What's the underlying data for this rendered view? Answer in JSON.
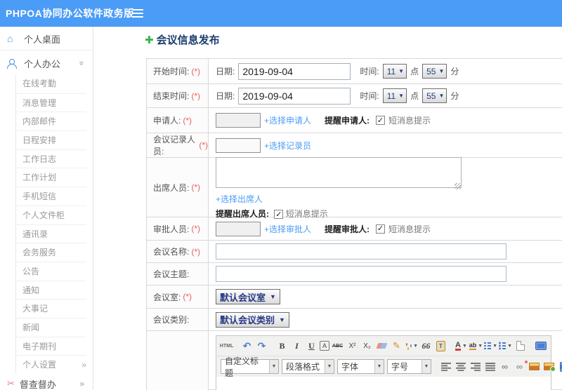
{
  "header": {
    "title": "PHPOA协同办公软件政务版"
  },
  "sidebar": {
    "desktop": {
      "label": "个人桌面"
    },
    "personal_office": {
      "label": "个人办公",
      "children": [
        "在线考勤",
        "消息管理",
        "内部邮件",
        "日程安排",
        "工作日志",
        "工作计划",
        "手机短信",
        "个人文件柜",
        "通讯录",
        "会务服务",
        "公告",
        "通知",
        "大事记",
        "新闻",
        "电子期刊"
      ]
    },
    "personal_settings": {
      "label": "个人设置"
    },
    "supervision": {
      "label": "督查督办"
    }
  },
  "page": {
    "title": "会议信息发布"
  },
  "form": {
    "required_mark": "(*)",
    "start_time": {
      "label": "开始时间:",
      "date_label": "日期:",
      "date_value": "2019-09-04",
      "time_label": "时间:",
      "hour": "11",
      "hour_unit": "点",
      "minute": "55",
      "minute_unit": "分"
    },
    "end_time": {
      "label": "结束时间:",
      "date_label": "日期:",
      "date_value": "2019-09-04",
      "time_label": "时间:",
      "hour": "11",
      "hour_unit": "点",
      "minute": "55",
      "minute_unit": "分"
    },
    "applicant": {
      "label": "申请人:",
      "link": "+选择申请人",
      "remind_label": "提醒申请人:",
      "sms_label": "短消息提示"
    },
    "recorder": {
      "label": "会议记录人员:",
      "link": "+选择记录员"
    },
    "attendees": {
      "label": "出席人员:",
      "link": "+选择出席人",
      "remind_label": "提醒出席人员:",
      "sms_label": "短消息提示"
    },
    "approver": {
      "label": "审批人员:",
      "link": "+选择审批人",
      "remind_label": "提醒审批人:",
      "sms_label": "短消息提示"
    },
    "meeting_name": {
      "label": "会议名称:"
    },
    "meeting_subject": {
      "label": "会议主题:"
    },
    "meeting_room": {
      "label": "会议室:",
      "value": "默认会议室"
    },
    "meeting_category": {
      "label": "会议类别:",
      "value": "默认会议类别"
    }
  },
  "editor": {
    "toolbar1": {
      "html": "HTML",
      "undo": "↶",
      "redo": "↷",
      "bold": "B",
      "italic": "I",
      "underline": "U",
      "font_box": "A",
      "strike": "ABC",
      "sup": "X²",
      "sub": "X₂",
      "broom": "✎",
      "quote": "66",
      "paste": "T",
      "font_color": "A",
      "highlight": "ab"
    },
    "toolbar2": {
      "heading": "自定义标题",
      "paragraph": "段落格式",
      "font": "字体",
      "size": "字号",
      "link": "∞",
      "unlink": "∞"
    }
  },
  "colors": {
    "header_bg": "#4b9cf6",
    "link": "#4a9cf8",
    "title": "#1c3c6e",
    "plus": "#3cb24a",
    "required": "#f25b5b"
  }
}
